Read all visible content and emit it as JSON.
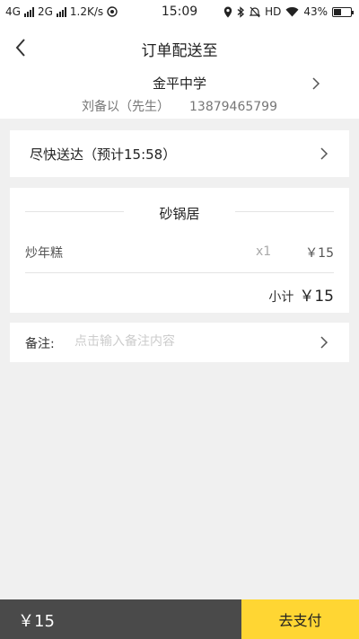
{
  "status_bar": {
    "network_1": "4G",
    "network_2": "2G",
    "speed": "1.2K/s",
    "time": "15:09",
    "hd": "HD",
    "battery_text": "43%",
    "battery_level": 0.43
  },
  "header": {
    "title": "订单配送至",
    "back_icon": "chevron-left-icon"
  },
  "address": {
    "place": "金平中学",
    "contact_name": "刘备以（先生）",
    "phone": "13879465799",
    "chevron_icon": "chevron-right-icon"
  },
  "delivery": {
    "text": "尽快送达（预计15:58）",
    "chevron_icon": "chevron-right-icon"
  },
  "order": {
    "shop_name": "砂锅居",
    "items": [
      {
        "name": "炒年糕",
        "qty": "x1",
        "price": "￥15"
      }
    ],
    "subtotal_label": "小计",
    "subtotal_value": "￥15"
  },
  "note": {
    "label": "备注:",
    "placeholder": "点击输入备注内容",
    "value": "",
    "chevron_icon": "chevron-right-icon"
  },
  "bottom_bar": {
    "total": "￥15",
    "pay_label": "去支付"
  },
  "colors": {
    "accent": "#ffd633",
    "bottom_dark": "#4a4a4a",
    "background": "#f0f0f0"
  }
}
